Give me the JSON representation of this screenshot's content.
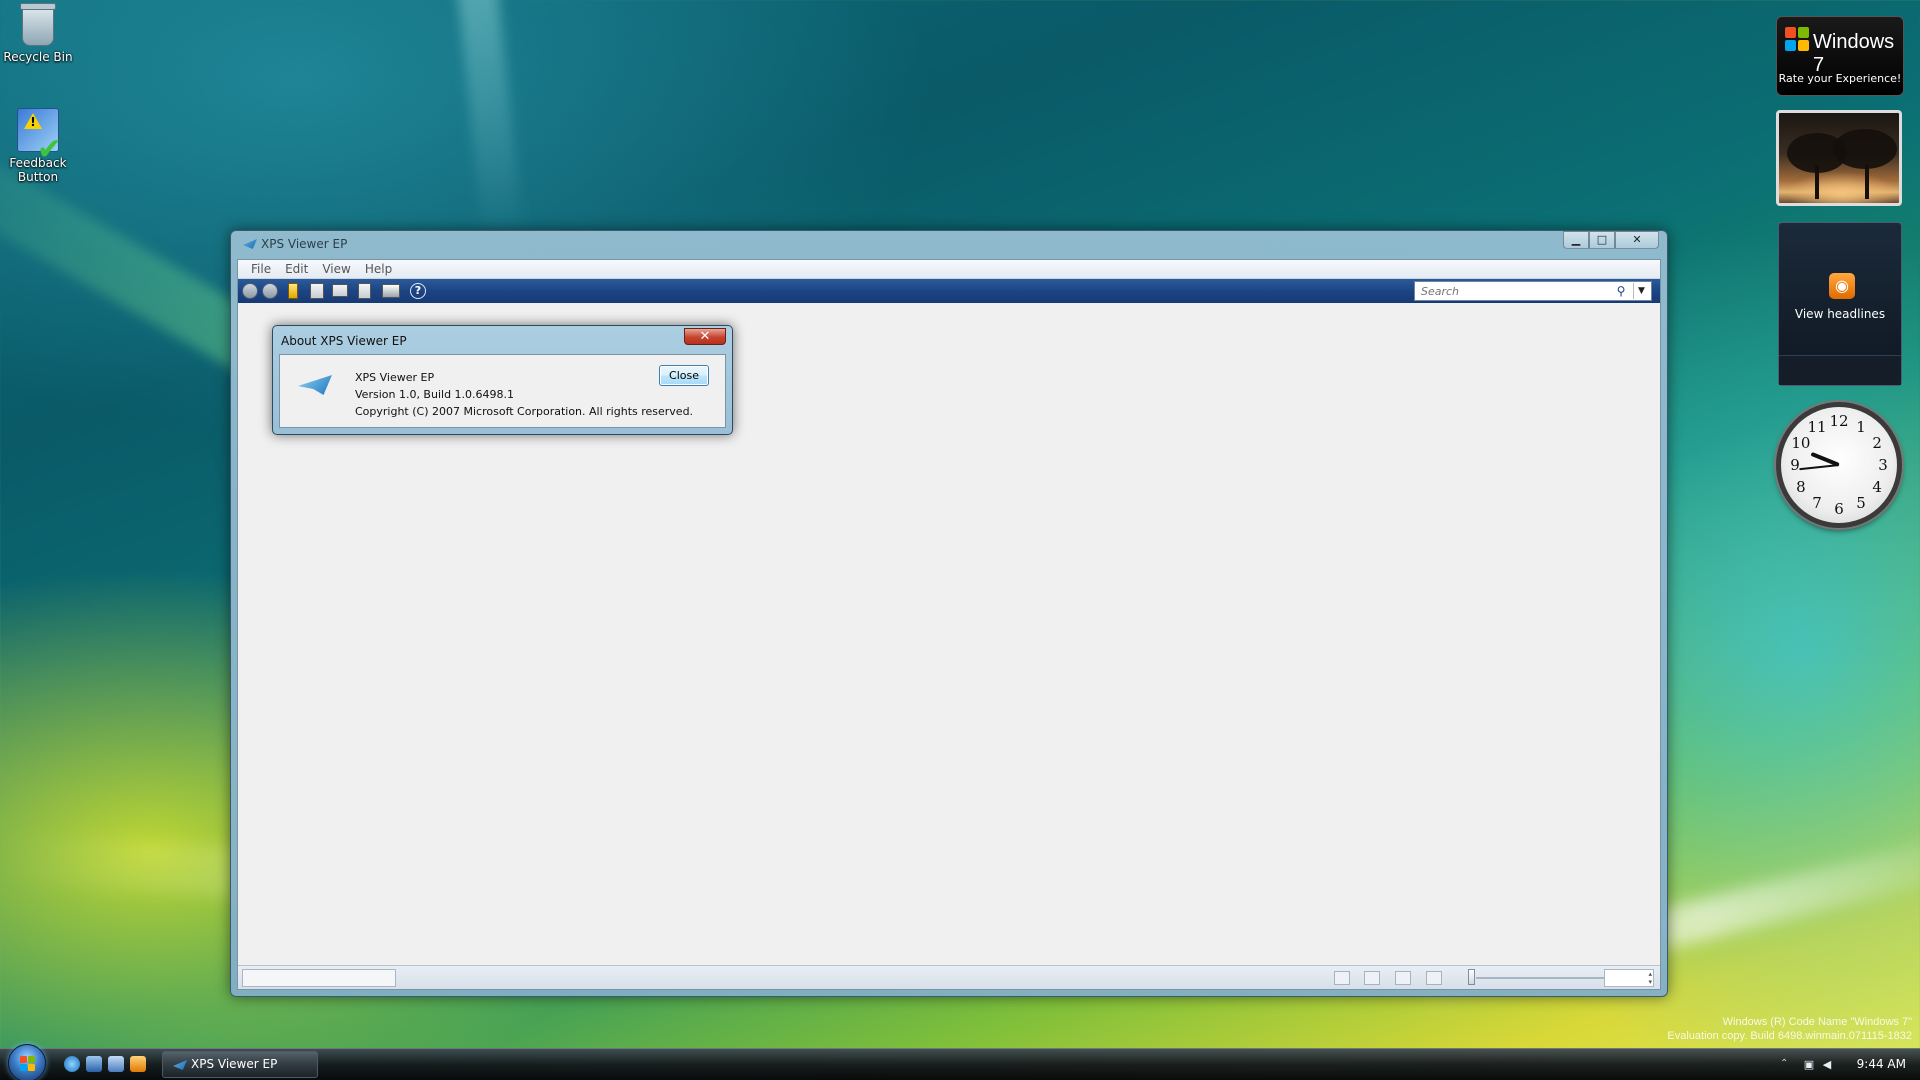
{
  "desktop": {
    "icons": [
      {
        "label": "Recycle Bin"
      },
      {
        "label_line1": "Feedback",
        "label_line2": "Button"
      }
    ]
  },
  "gadgets": {
    "win7": {
      "title": "Windows 7",
      "subtitle": "Rate your Experience!"
    },
    "feed": {
      "label": "View headlines"
    },
    "clock": {
      "numbers": [
        "12",
        "1",
        "2",
        "3",
        "4",
        "5",
        "6",
        "7",
        "8",
        "9",
        "10",
        "11"
      ],
      "hour": 9,
      "minute": 44
    }
  },
  "window": {
    "title": "XPS Viewer EP",
    "menu": [
      "File",
      "Edit",
      "View",
      "Help"
    ],
    "search": {
      "placeholder": "Search"
    },
    "toolbar_icons": [
      "back-icon",
      "forward-icon",
      "bookmark-icon",
      "new-document-icon",
      "document-icon",
      "save-icon",
      "print-icon",
      "help-icon"
    ],
    "status": {
      "icons": [
        "actual-size-icon",
        "fit-width-icon",
        "fit-page-icon",
        "thumbnails-icon"
      ],
      "zoom": ""
    }
  },
  "about_dialog": {
    "title": "About XPS Viewer EP",
    "product": "XPS Viewer EP",
    "version": "Version 1.0, Build 1.0.6498.1",
    "copyright": "Copyright (C) 2007 Microsoft Corporation.  All rights reserved.",
    "close_label": "Close",
    "close_glyph": "✕"
  },
  "watermark": {
    "line1": "Windows (R) Code Name \"Windows 7\"",
    "line2": "Evaluation copy. Build 6498.winmain.071115-1832"
  },
  "taskbar": {
    "task_label": "XPS Viewer EP",
    "time": "9:44 AM"
  },
  "colors": {
    "toolbar": "#1d4483",
    "close_red": "#c7432e",
    "rss_orange": "#ff8a00"
  }
}
